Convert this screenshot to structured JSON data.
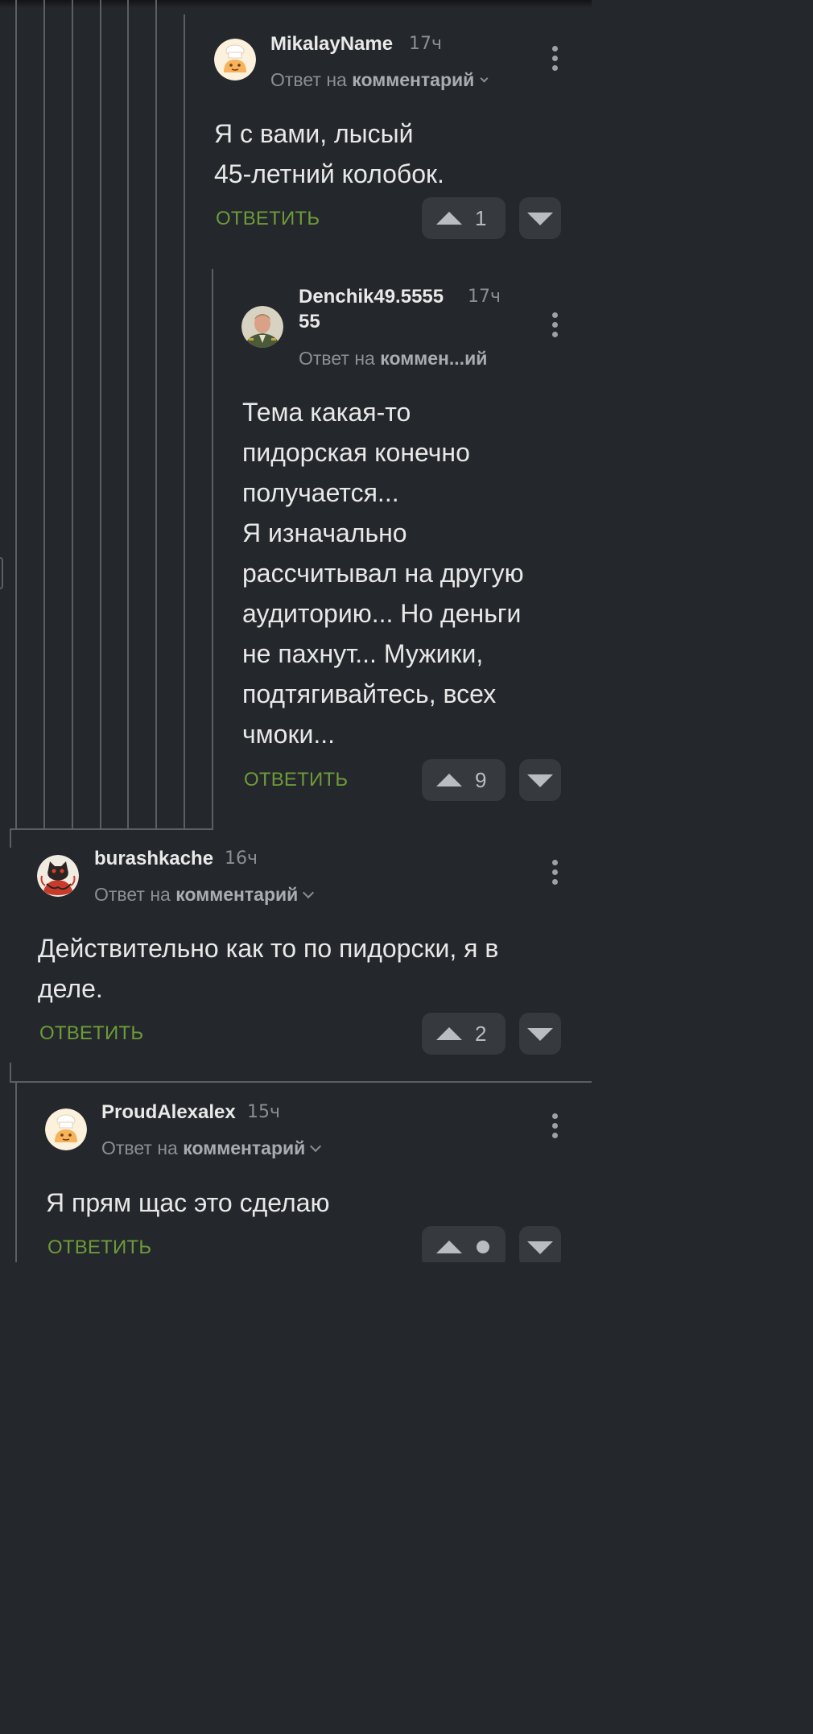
{
  "comments": [
    {
      "username": "MikalayName",
      "time": "17ч",
      "reply_prefix": "Ответ на",
      "reply_target": "комментарий",
      "text": "Я с вами, лысый\n45-летний колобок.",
      "reply_label": "ОТВЕТИТЬ",
      "votes": "1",
      "avatar": "chef-avatar-icon"
    },
    {
      "username_line1": "Denchik49.5555",
      "username_line2": "55",
      "time": "17ч",
      "reply_prefix": "Ответ на",
      "reply_target": "коммен...ий",
      "text": "Тема какая-то\nпидорская конечно\nполучается...\nЯ изначально\nрассчитывал на другую\nаудиторию... Но деньги\nне пахнут... Мужики,\nподтягивайтесь, всех\nчмоки...",
      "reply_label": "ОТВЕТИТЬ",
      "votes": "9",
      "avatar": "user-photo-avatar"
    },
    {
      "username": "burashkache",
      "time": "16ч",
      "reply_prefix": "Ответ на",
      "reply_target": "комментарий",
      "text": "Действительно как то по пидорски, я в\nделе.",
      "reply_label": "ОТВЕТИТЬ",
      "votes": "2",
      "avatar": "cat-drawing-avatar"
    },
    {
      "username": "ProudAlexalex",
      "time": "15ч",
      "reply_prefix": "Ответ на",
      "reply_target": "комментарий",
      "text": "Я прям щас это сделаю",
      "reply_label": "ОТВЕТИТЬ",
      "votes": "",
      "avatar": "chef-avatar-icon"
    }
  ],
  "colors": {
    "background": "#24272b",
    "reply_green": "#6d9b3a",
    "thread_line": "#5b5f64",
    "vote_bg": "#36393e"
  }
}
